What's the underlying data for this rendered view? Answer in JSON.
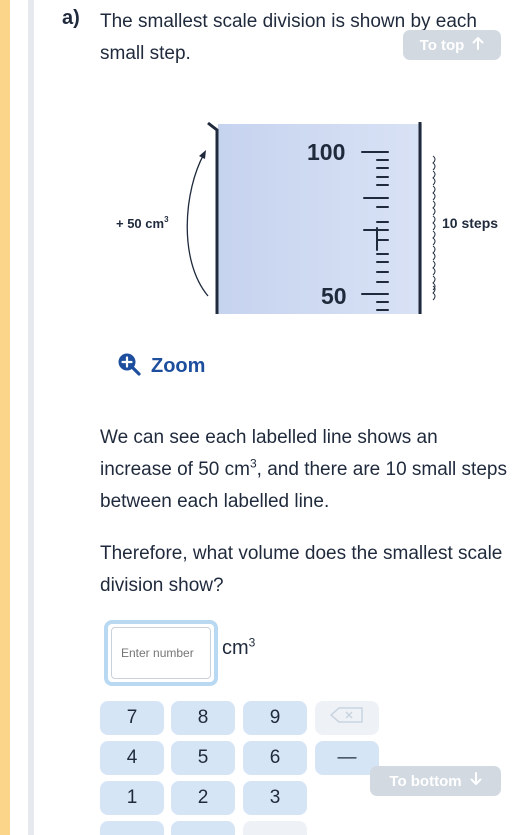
{
  "question": {
    "label": "a)",
    "text": "The smallest scale division is shown by each small step."
  },
  "nav": {
    "to_top": "To top",
    "to_bottom": "To bottom"
  },
  "diagram": {
    "label_100": "100",
    "label_50": "50",
    "arc_label": "+ 50 cm",
    "arc_label_sup": "3",
    "steps_label": "10 steps"
  },
  "zoom": {
    "label": "Zoom"
  },
  "explanation": {
    "p1_a": "We can see each labelled line shows an increase of 50 cm",
    "p1_sup": "3",
    "p1_b": ", and there are 10 small steps between each labelled line.",
    "p2": "Therefore, what volume does the smallest scale division show?"
  },
  "answer": {
    "placeholder": "Enter number",
    "unit": "cm",
    "unit_sup": "3"
  },
  "keypad": {
    "keys": [
      "7",
      "8",
      "9",
      "4",
      "5",
      "6",
      "1",
      "2",
      "3"
    ],
    "minus": "—"
  },
  "colors": {
    "accent": "#1d4f9e",
    "beaker_fill": "#c7d4f0",
    "key_bg": "#d5e5f6",
    "stripe": "#fbd68a"
  }
}
